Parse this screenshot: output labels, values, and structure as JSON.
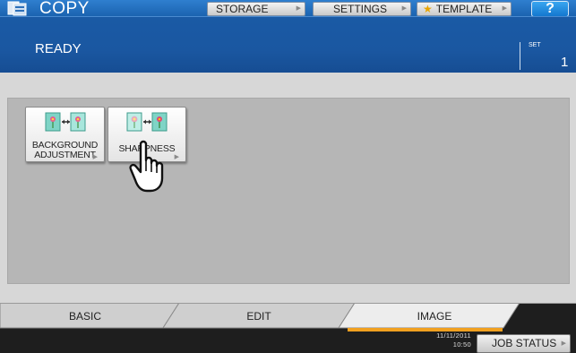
{
  "header": {
    "title": "COPY",
    "app_icon": "copy-icon",
    "buttons": {
      "storage": "STORAGE",
      "settings": "SETTINGS",
      "template": "TEMPLATE",
      "help": "?"
    }
  },
  "status": {
    "text": "READY",
    "set_label": "SET",
    "set_value": "1"
  },
  "functions": [
    {
      "label_line1": "BACKGROUND",
      "label_line2": "ADJUSTMENT",
      "icon": "background-adjustment-icon"
    },
    {
      "label_line1": "SHARPNESS",
      "icon": "sharpness-icon"
    }
  ],
  "tabs": [
    {
      "label": "BASIC",
      "active": false
    },
    {
      "label": "EDIT",
      "active": false
    },
    {
      "label": "IMAGE",
      "active": true
    }
  ],
  "footer": {
    "date": "11/11/2011",
    "time": "10:50",
    "job_status": "JOB STATUS"
  },
  "colors": {
    "header_blue": "#1a5aa5",
    "active_tab_underline": "#f0a020",
    "help_button": "#1e88d8"
  }
}
